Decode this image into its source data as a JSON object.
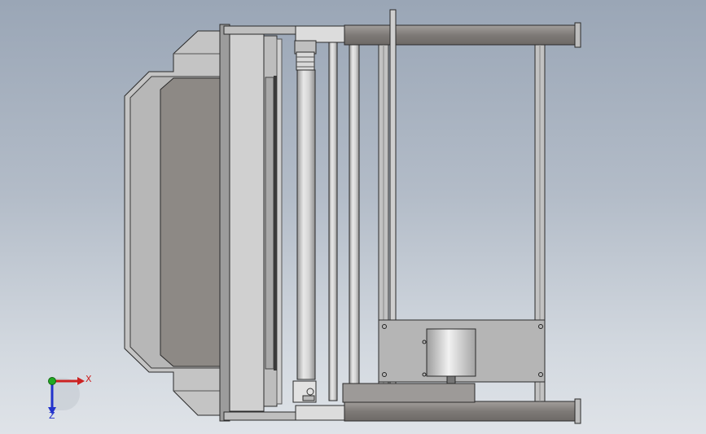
{
  "viewport": {
    "background_top": "#9aa6b6",
    "background_bottom": "#dfe3e8"
  },
  "model": {
    "colors": {
      "outline": "#2a2a2a",
      "panel_light": "#c9c9c9",
      "panel_mid": "#a9a9a9",
      "panel_dark": "#8c8884",
      "frame_tube": "#8a8683",
      "rod": "#cfcfcf",
      "motor": "#d8d8d8"
    }
  },
  "triad": {
    "x_label": "X",
    "z_label": "Z",
    "x_color": "#cc2222",
    "y_color": "#22aa22",
    "z_color": "#2233cc"
  }
}
